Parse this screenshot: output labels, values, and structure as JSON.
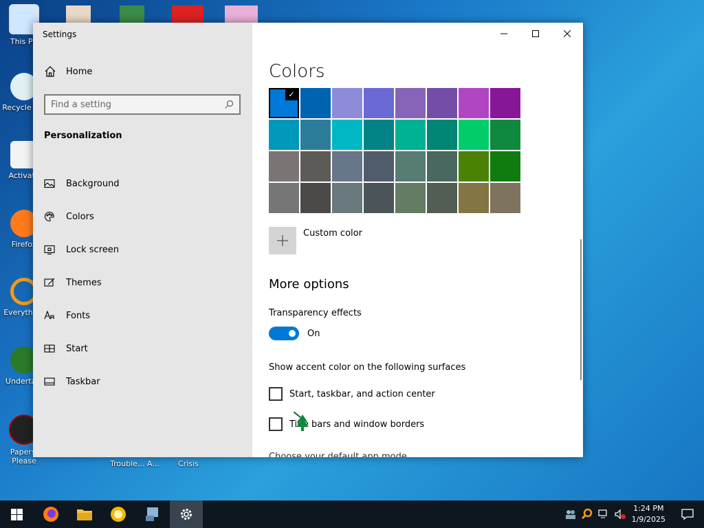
{
  "window": {
    "title": "Settings"
  },
  "sidebar": {
    "home": "Home",
    "search_placeholder": "Find a setting",
    "section": "Personalization",
    "items": [
      {
        "label": "Background",
        "icon": "picture-icon"
      },
      {
        "label": "Colors",
        "icon": "palette-icon"
      },
      {
        "label": "Lock screen",
        "icon": "lock-screen-icon"
      },
      {
        "label": "Themes",
        "icon": "brush-icon"
      },
      {
        "label": "Fonts",
        "icon": "font-icon"
      },
      {
        "label": "Start",
        "icon": "start-icon"
      },
      {
        "label": "Taskbar",
        "icon": "taskbar-icon"
      }
    ]
  },
  "main": {
    "title": "Colors",
    "swatches": [
      "#0078d7",
      "#0063b1",
      "#8e8cd8",
      "#6b69d6",
      "#8764b8",
      "#744da9",
      "#b146c2",
      "#881798",
      "#0099bc",
      "#2d7d9a",
      "#00b7c3",
      "#038387",
      "#00b294",
      "#018574",
      "#00cc6a",
      "#10893e",
      "#7a7574",
      "#5d5a58",
      "#68768a",
      "#515c6b",
      "#567c73",
      "#486860",
      "#498205",
      "#107c10",
      "#767676",
      "#4c4a48",
      "#69797e",
      "#4a5459",
      "#647c64",
      "#525e54",
      "#847545",
      "#7e735f"
    ],
    "selected_swatch": 0,
    "custom_color": "Custom color",
    "more_options": "More options",
    "transparency_label": "Transparency effects",
    "transparency_state": "On",
    "accent_surfaces_label": "Show accent color on the following surfaces",
    "checkbox_start": "Start, taskbar, and action center",
    "checkbox_title_bars": "Title bars and window borders",
    "default_app_mode": "Choose your default app mode"
  },
  "desktop": {
    "icons": [
      "This PC",
      "Recycle Bin",
      "Activate",
      "Firefox",
      "Everything",
      "Undertale",
      "Papers, Please"
    ],
    "bottom_labels": [
      "Trouble... A...",
      "Crisis"
    ]
  },
  "taskbar": {
    "time": "1:24 PM",
    "date": "1/9/2025"
  },
  "colors": {
    "accent": "#0078d7"
  }
}
